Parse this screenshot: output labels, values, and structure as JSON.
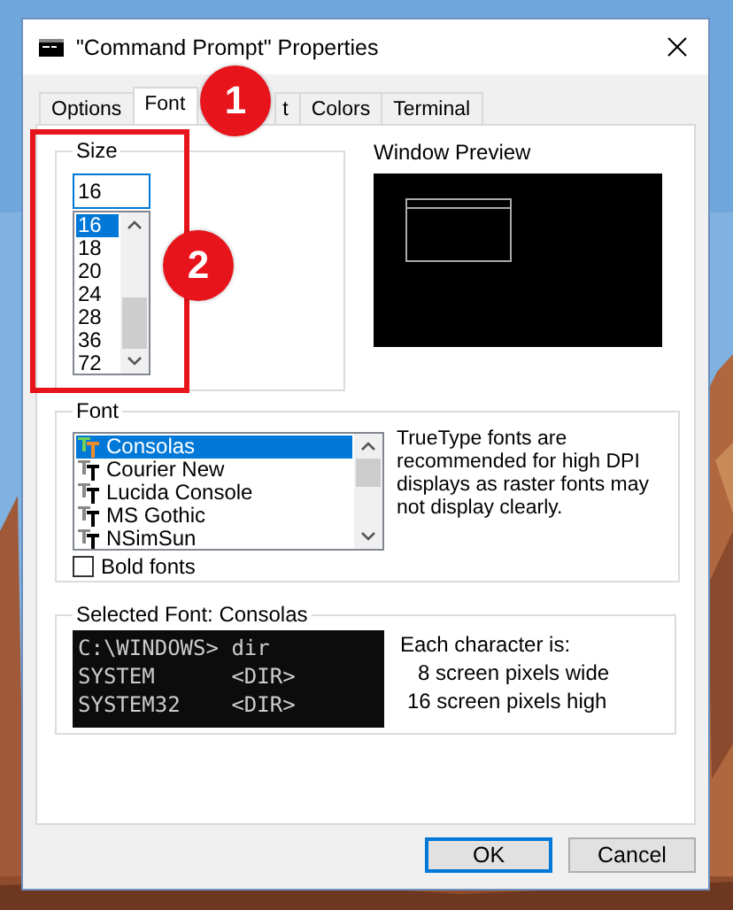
{
  "window": {
    "title": "\"Command Prompt\" Properties"
  },
  "tabs": [
    {
      "label": "Options",
      "selected": false
    },
    {
      "label": "Font",
      "selected": true
    },
    {
      "label": "t",
      "selected": false
    },
    {
      "label": "Colors",
      "selected": false
    },
    {
      "label": "Terminal",
      "selected": false
    }
  ],
  "size": {
    "legend": "Size",
    "value": "16",
    "options": [
      {
        "label": "16",
        "selected": true
      },
      {
        "label": "18",
        "selected": false
      },
      {
        "label": "20",
        "selected": false
      },
      {
        "label": "24",
        "selected": false
      },
      {
        "label": "28",
        "selected": false
      },
      {
        "label": "36",
        "selected": false
      },
      {
        "label": "72",
        "selected": false
      }
    ]
  },
  "window_preview": {
    "label": "Window Preview"
  },
  "font": {
    "legend": "Font",
    "items": [
      {
        "label": "Consolas",
        "selected": true
      },
      {
        "label": "Courier New",
        "selected": false
      },
      {
        "label": "Lucida Console",
        "selected": false
      },
      {
        "label": "MS Gothic",
        "selected": false
      },
      {
        "label": "NSimSun",
        "selected": false
      }
    ],
    "note": "TrueType fonts are recommended for high DPI displays as raster fonts may not display clearly.",
    "bold": {
      "label": "Bold fonts",
      "checked": false
    }
  },
  "selected_font": {
    "legend": "Selected Font: Consolas",
    "preview_lines": [
      "C:\\WINDOWS> dir",
      "SYSTEM      <DIR>",
      "SYSTEM32    <DIR>"
    ],
    "info": [
      "Each character is:",
      "8 screen pixels wide",
      "16 screen pixels high"
    ]
  },
  "buttons": [
    {
      "label": "OK",
      "default": true
    },
    {
      "label": "Cancel",
      "default": false
    }
  ],
  "annotations": [
    {
      "number": "1"
    },
    {
      "number": "2"
    }
  ]
}
